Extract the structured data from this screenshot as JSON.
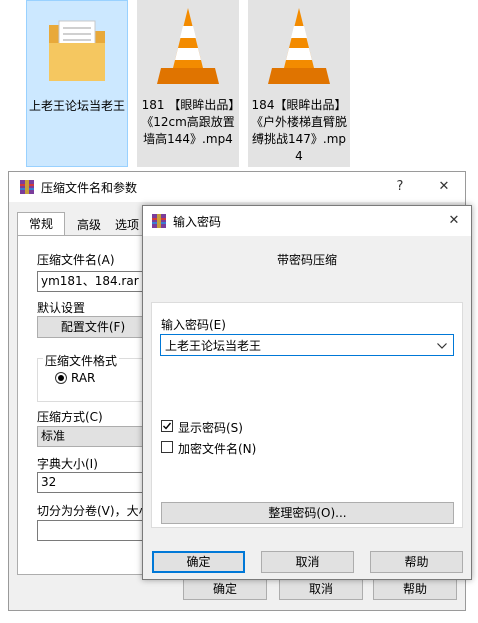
{
  "files": [
    {
      "name": "上老王论坛当老王"
    },
    {
      "name": "181 【眼眸出品】《12cm高跟放置墙高144》.mp4"
    },
    {
      "name": "184【眼眸出品】《户外楼梯直臂脱缚挑战147》.mp4"
    }
  ],
  "archive_dialog": {
    "title": "压缩文件名和参数",
    "help_btn": "?",
    "close_btn": "✕",
    "tabs": [
      "常规",
      "高级",
      "选项"
    ],
    "archive_name_label": "压缩文件名(A)",
    "archive_name_value": "ym181、184.rar",
    "default_settings_label": "默认设置",
    "profiles_button": "配置文件(F)",
    "format_group_label": "压缩文件格式",
    "format_rar": "RAR",
    "method_label": "压缩方式(C)",
    "method_value": "标准",
    "dict_label": "字典大小(I)",
    "dict_value": "32",
    "split_label": "切分为分卷(V)，大小",
    "ok": "确定",
    "cancel": "取消",
    "help": "帮助"
  },
  "password_dialog": {
    "title": "输入密码",
    "close_btn": "✕",
    "heading": "带密码压缩",
    "password_label": "输入密码(E)",
    "password_value": "上老王论坛当老王",
    "show_password": "显示密码(S)",
    "show_password_checked": true,
    "encrypt_names": "加密文件名(N)",
    "encrypt_names_checked": false,
    "organize_button": "整理密码(O)...",
    "ok": "确定",
    "cancel": "取消",
    "help": "帮助"
  },
  "colors": {
    "accent": "#0078d7",
    "selection": "#cce8ff",
    "folder": "#f5c760",
    "vlc_orange": "#f38b00"
  }
}
